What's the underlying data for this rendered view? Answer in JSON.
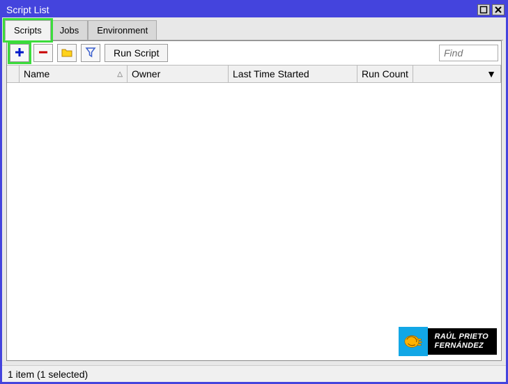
{
  "window": {
    "title": "Script List"
  },
  "tabs": [
    {
      "label": "Scripts",
      "active": true,
      "highlighted": true
    },
    {
      "label": "Jobs",
      "active": false,
      "highlighted": false
    },
    {
      "label": "Environment",
      "active": false,
      "highlighted": false
    }
  ],
  "toolbar": {
    "add": {
      "highlighted": true
    },
    "remove": {},
    "folder": {},
    "filter": {},
    "run_label": "Run Script",
    "find_placeholder": "Find"
  },
  "columns": {
    "name": "Name",
    "owner": "Owner",
    "last": "Last Time Started",
    "run": "Run Count"
  },
  "statusbar": {
    "text": "1 item (1 selected)"
  },
  "watermark": {
    "line1": "RAÚL PRIETO",
    "line2": "FERNÁNDEZ"
  }
}
